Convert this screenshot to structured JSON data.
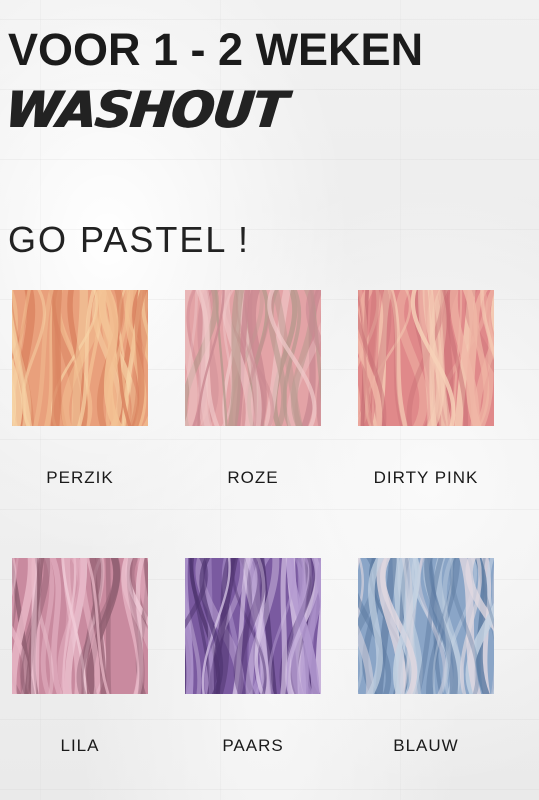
{
  "header": {
    "title": "VOOR 1 - 2 WEKEN",
    "subtitle": "WASHOUT"
  },
  "section": {
    "title": "GO PASTEL !"
  },
  "swatches": [
    {
      "label": "PERZIK",
      "colors": [
        "#e9a07c",
        "#f3c294",
        "#d9825f",
        "#f7d6a8"
      ]
    },
    {
      "label": "ROZE",
      "colors": [
        "#e3a3a6",
        "#f0c9c9",
        "#c98891",
        "#b79a8e"
      ]
    },
    {
      "label": "DIRTY PINK",
      "colors": [
        "#e0898a",
        "#f0b7a6",
        "#c86f75",
        "#f6d1b8"
      ]
    },
    {
      "label": "LILA",
      "colors": [
        "#c98a9f",
        "#e7b6c6",
        "#8d5d6f",
        "#f0cbd7"
      ]
    },
    {
      "label": "PAARS",
      "colors": [
        "#7a5aa0",
        "#b39ad0",
        "#4f3470",
        "#d8c6e6"
      ]
    },
    {
      "label": "BLAUW",
      "colors": [
        "#8aa5c7",
        "#c4d2e2",
        "#5f7da3",
        "#e0d8e0"
      ]
    }
  ]
}
